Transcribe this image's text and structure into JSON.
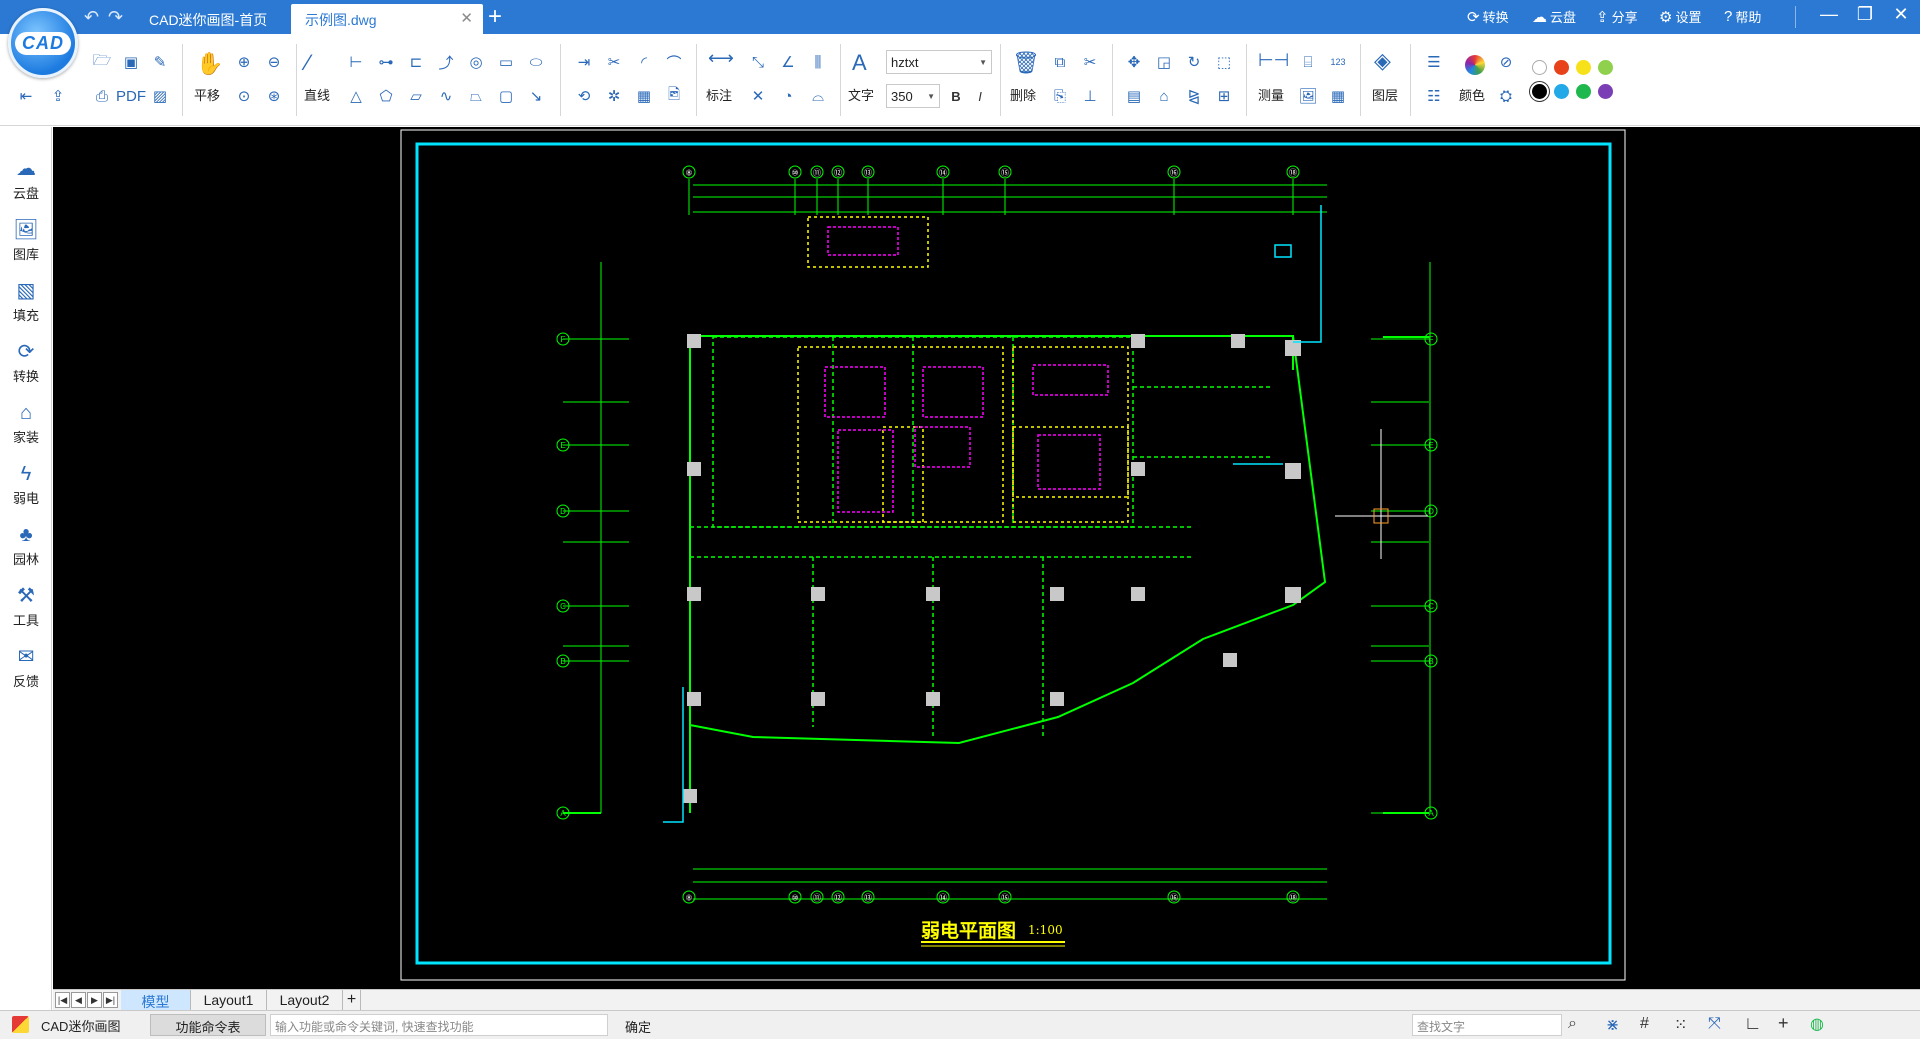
{
  "app": {
    "logo_text": "CAD",
    "tabs": [
      {
        "label": "CAD迷你画图-首页"
      },
      {
        "label": "示例图.dwg"
      }
    ],
    "top_right": [
      {
        "label": "转换",
        "icon": "convert-icon"
      },
      {
        "label": "云盘",
        "icon": "cloud-icon"
      },
      {
        "label": "分享",
        "icon": "share-icon"
      },
      {
        "label": "设置",
        "icon": "gear-icon"
      },
      {
        "label": "帮助",
        "icon": "help-icon"
      }
    ]
  },
  "ribbon": {
    "pan_label": "平移",
    "line_label": "直线",
    "dim_label": "标注",
    "text_label": "文字",
    "font_value": "hztxt",
    "size_value": "350",
    "bold_label": "B",
    "italic_label": "I",
    "delete_label": "删除",
    "measure_label": "测量",
    "layer_label": "图层",
    "color_label": "颜色",
    "colors": [
      "#ffffff",
      "#e8421b",
      "#f7e11a",
      "#8fd04c",
      "#000000",
      "#23a9e8",
      "#1fb84e",
      "#7a3fb5"
    ]
  },
  "sidebar": {
    "items": [
      {
        "label": "云盘",
        "icon": "cloud-icon"
      },
      {
        "label": "图库",
        "icon": "gallery-icon"
      },
      {
        "label": "填充",
        "icon": "fill-icon"
      },
      {
        "label": "转换",
        "icon": "convert-icon"
      },
      {
        "label": "家装",
        "icon": "home-icon"
      },
      {
        "label": "弱电",
        "icon": "lightning-icon"
      },
      {
        "label": "园林",
        "icon": "tree-icon"
      },
      {
        "label": "工具",
        "icon": "tools-icon"
      },
      {
        "label": "反馈",
        "icon": "mail-icon"
      }
    ]
  },
  "drawing": {
    "title": "弱电平面图",
    "scale": "1:100",
    "grid_top": [
      "⑧",
      "⑩",
      "⑪",
      "⑫",
      "⑬",
      "⑭",
      "⑮",
      "⑯",
      "⑱"
    ],
    "grid_right": [
      "F",
      "E",
      "D",
      "C",
      "B",
      "A"
    ]
  },
  "layout_tabs": [
    "模型",
    "Layout1",
    "Layout2"
  ],
  "status": {
    "app_name": "CAD迷你画图",
    "cmd_table": "功能命令表",
    "cmd_placeholder": "输入功能或命令关键词, 快速查找功能",
    "confirm": "确定",
    "search_placeholder": "查找文字"
  }
}
